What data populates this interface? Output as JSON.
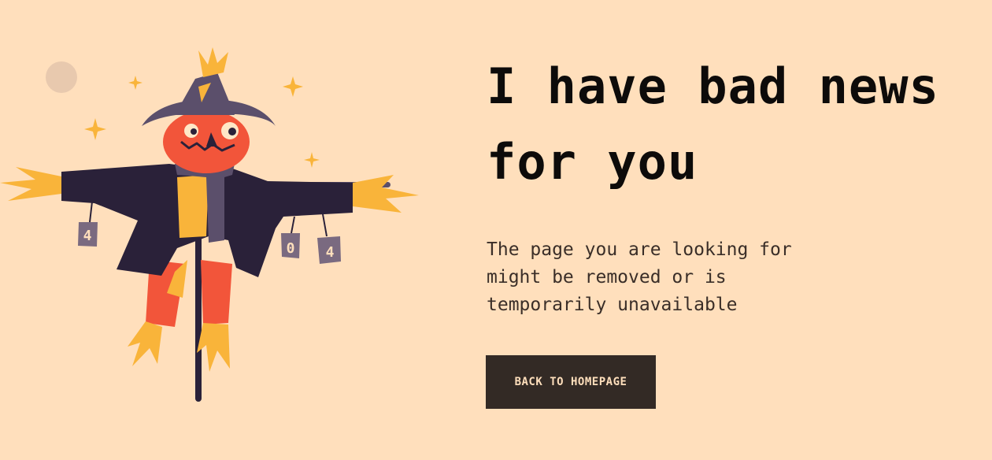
{
  "main": {
    "headline": "I have bad news for you",
    "subtext": "The page you are looking for might be removed or is temporarily unavailable",
    "back_button_label": "BACK TO HOMEPAGE"
  },
  "illustration": {
    "subject": "scarecrow-illustration",
    "cans": [
      "4",
      "0",
      "4"
    ]
  },
  "colors": {
    "background": "#FFDFBC",
    "text": "#0D0B0A",
    "button_bg": "#332A25",
    "button_text": "#FFDFBC",
    "pumpkin": "#F2553A",
    "straw": "#F9B43A",
    "coat": "#2A2139",
    "hat": "#5B4F6B"
  }
}
